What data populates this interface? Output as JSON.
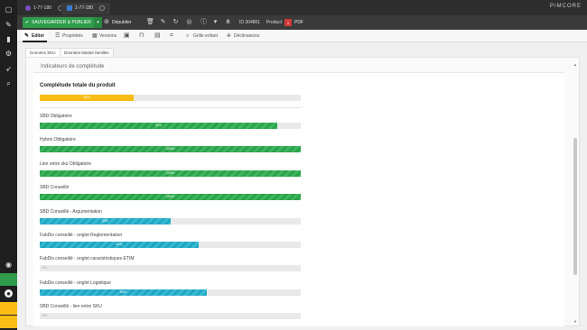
{
  "window": {
    "tabs": [
      {
        "label": "1-77-180",
        "active": false
      },
      {
        "label": "1-77-180",
        "active": true
      }
    ],
    "brand": "PIMCORE"
  },
  "toolbar": {
    "save_publish": "SAUVEGARDER & PUBLIER",
    "unpublish": "Dépublier",
    "id": "ID 304801",
    "type": "Product",
    "pdf": "PDF"
  },
  "subtabs": [
    {
      "label": "Editer"
    },
    {
      "label": "Propriétés"
    },
    {
      "label": "Versions"
    },
    {
      "label": ""
    },
    {
      "label": ""
    },
    {
      "label": ""
    },
    {
      "label": ""
    },
    {
      "label": "Grille enfant"
    },
    {
      "label": "Déclinaisons"
    }
  ],
  "data_tabs": [
    "Données SKU",
    "Données Master familles"
  ],
  "panel_title": "Indicateurs de complétude",
  "summary": {
    "title": "Complétude totale du produit",
    "value": 36,
    "value_label": "36%"
  },
  "indicators": [
    {
      "label": "SBD Obligatoire",
      "value": 91,
      "value_label": "91%",
      "color": "green"
    },
    {
      "label": "Hybris Obligatoire",
      "value": 100,
      "value_label": "100%",
      "color": "green"
    },
    {
      "label": "Lien entre sku Obligatoire",
      "value": 100,
      "value_label": "100%",
      "color": "green"
    },
    {
      "label": "SBD Conseillé",
      "value": 100,
      "value_label": "100%",
      "color": "green"
    },
    {
      "label": "SBD Conseillé - Argumentation",
      "value": 50,
      "value_label": "50%",
      "color": "blue"
    },
    {
      "label": "FabDis conseillé - onglet Reglementation",
      "value": 61,
      "value_label": "61%",
      "color": "blue"
    },
    {
      "label": "FabDis conseillé - onglet caractéristiques ETIM",
      "value": 0,
      "value_label": "0%",
      "color": "blue"
    },
    {
      "label": "FabDis conseillé - onglet Logistique",
      "value": 64,
      "value_label": "64%",
      "color": "blue"
    },
    {
      "label": "SBD Conseillé - lien entre SKU",
      "value": 0,
      "value_label": "0%",
      "color": "blue"
    }
  ],
  "colors": {
    "green": "#2aa24a",
    "blue": "#1fa6c3",
    "yellow": "#fbbd15",
    "save": "#2e9c4a"
  }
}
